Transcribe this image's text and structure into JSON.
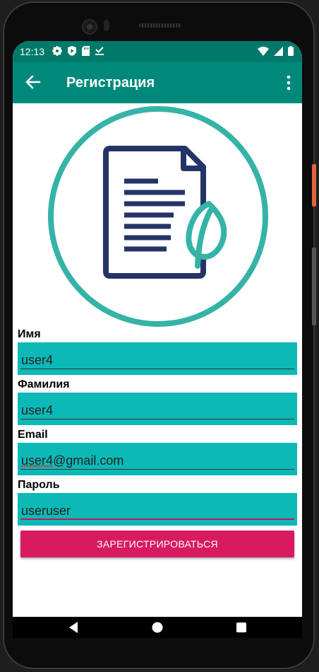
{
  "status": {
    "time": "12:13",
    "left_icons": [
      "gear-icon",
      "play-protect-icon",
      "sd-card-icon",
      "download-done-icon"
    ],
    "right_icons": [
      "wifi-icon",
      "signal-icon",
      "battery-icon"
    ]
  },
  "appbar": {
    "title": "Регистрация",
    "back_icon": "arrow-left-icon",
    "menu_icon": "more-vert-icon"
  },
  "colors": {
    "status_bar": "#00796b",
    "app_bar": "#00897b",
    "field_bg": "#0cb9b6",
    "button": "#d81b60",
    "logo_ring": "#35b3a6",
    "logo_doc": "#243466"
  },
  "form": {
    "first_name": {
      "label": "Имя",
      "value": "user4"
    },
    "last_name": {
      "label": "Фамилия",
      "value": "user4"
    },
    "email": {
      "label": "Email",
      "value": "user4@gmail.com"
    },
    "password": {
      "label": "Пароль",
      "value": "useruser"
    },
    "submit_label": "ЗАРЕГИСТРИРОВАТЬСЯ"
  },
  "navbar": {
    "back_icon": "nav-back-icon",
    "home_icon": "nav-home-icon",
    "recents_icon": "nav-recents-icon"
  }
}
